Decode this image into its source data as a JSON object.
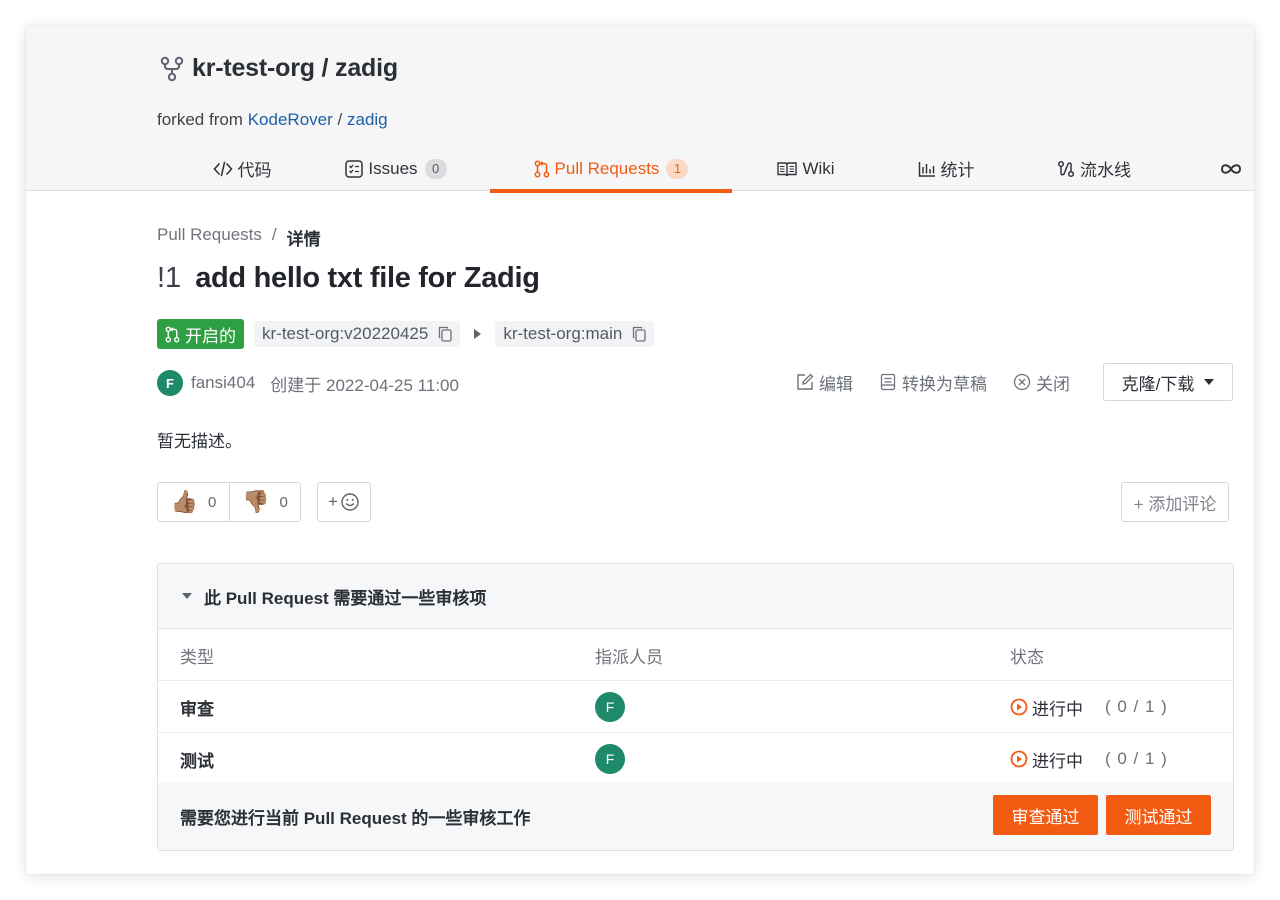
{
  "repo": {
    "title": "kr-test-org / zadig",
    "forked_prefix": "forked from",
    "forked_owner": "KodeRover",
    "forked_sep": "/",
    "forked_repo": "zadig"
  },
  "tabs": [
    {
      "label": "代码",
      "icon": "code-icon"
    },
    {
      "label": "Issues",
      "icon": "issues-icon",
      "badge": "0"
    },
    {
      "label": "Pull Requests",
      "icon": "pull-request-icon",
      "badge": "1",
      "active": true
    },
    {
      "label": "Wiki",
      "icon": "book-icon"
    },
    {
      "label": "统计",
      "icon": "bar-chart-icon"
    },
    {
      "label": "流水线",
      "icon": "pipeline-icon"
    },
    {
      "label": "",
      "icon": "infinity-icon"
    }
  ],
  "breadcrumb": {
    "parent": "Pull Requests",
    "sep": "/",
    "current": "详情"
  },
  "pr": {
    "number": "!1",
    "title": "add hello txt file for Zadig",
    "state_label": "开启的",
    "source_branch": "kr-test-org:v20220425",
    "target_branch": "kr-test-org:main",
    "author_initial": "F",
    "author": "fansi404",
    "created": "创建于 2022-04-25 11:00",
    "description": "暂无描述。"
  },
  "actions": {
    "edit": "编辑",
    "draft": "转换为草稿",
    "close": "关闭",
    "clone": "克隆/下载"
  },
  "reactions": {
    "thumbs_up": "👍🏽",
    "thumbs_up_count": "0",
    "thumbs_down": "👎🏽",
    "thumbs_down_count": "0",
    "emoji_plus": "+",
    "add_comment": "+ 添加评论"
  },
  "review": {
    "heading": "此 Pull Request 需要通过一些审核项",
    "columns": [
      "类型",
      "指派人员",
      "状态"
    ],
    "rows": [
      {
        "type": "审查",
        "assignee": "F",
        "state": "进行中",
        "count": "( 0 / 1 )"
      },
      {
        "type": "测试",
        "assignee": "F",
        "state": "进行中",
        "count": "( 0 / 1 )"
      }
    ],
    "footer_text": "需要您进行当前 Pull Request 的一些审核工作",
    "approve_review": "审查通过",
    "approve_test": "测试通过"
  },
  "colors": {
    "accent": "#f35b13",
    "open_green": "#2ea043",
    "avatar_green": "#1e8a6a"
  }
}
